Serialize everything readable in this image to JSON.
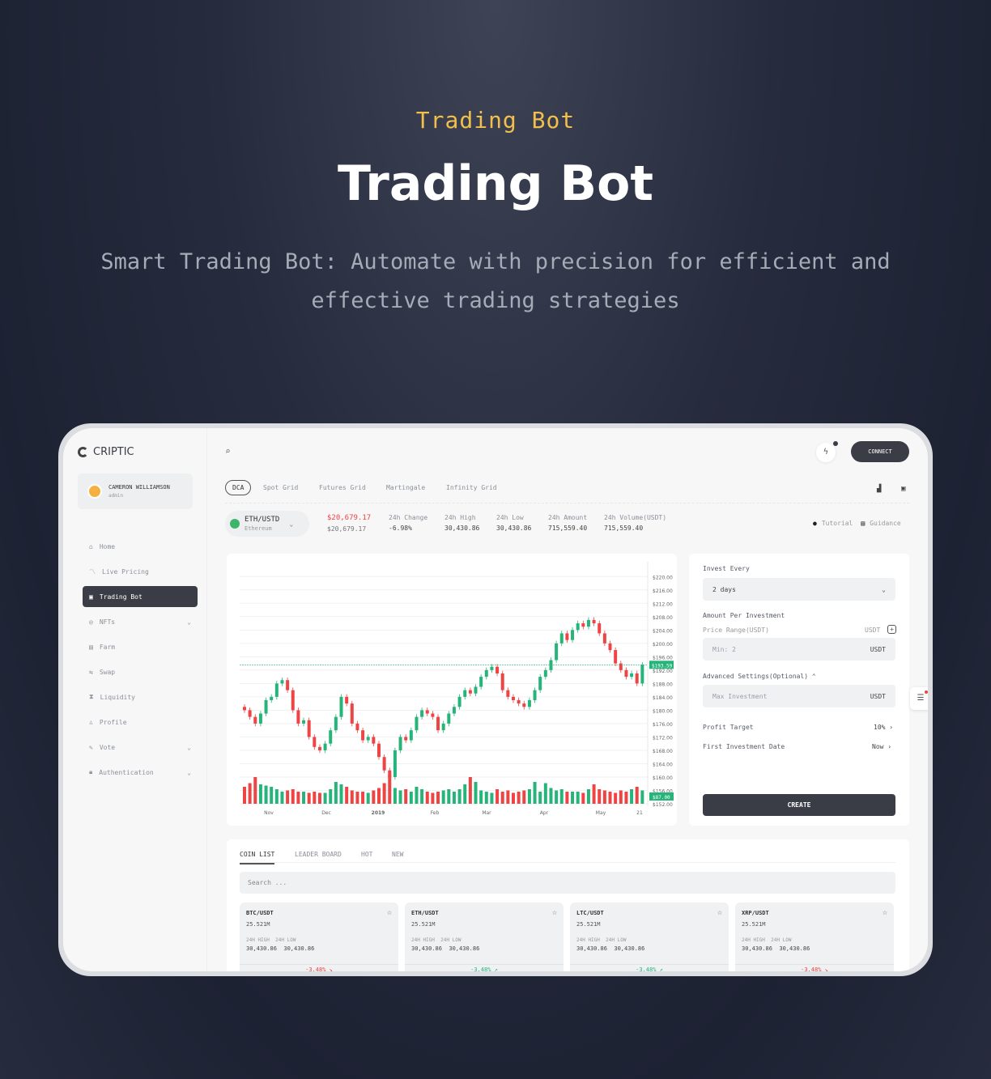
{
  "hero": {
    "eyebrow": "Trading Bot",
    "title": "Trading Bot",
    "subtitle": "Smart Trading Bot: Automate with precision for efficient and effective trading strategies"
  },
  "colors": {
    "accent": "#f2c04a",
    "up": "#26b47a",
    "down": "#ef4444",
    "dark": "#3a3d45"
  },
  "app": {
    "brand": "CRIPTIC",
    "connect": "CONNECT"
  },
  "user": {
    "name": "CAMERON WILLIAMSON",
    "role": "admin"
  },
  "sidebar": {
    "items": [
      {
        "label": "Home",
        "icon": "home-icon"
      },
      {
        "label": "Live Pricing",
        "icon": "chart-line-icon"
      },
      {
        "label": "Trading Bot",
        "icon": "bot-icon",
        "active": true
      },
      {
        "label": "NFTs",
        "icon": "nft-icon",
        "chevron": true
      },
      {
        "label": "Farm",
        "icon": "farm-icon"
      },
      {
        "label": "Swap",
        "icon": "swap-icon"
      },
      {
        "label": "Liquidity",
        "icon": "hourglass-icon"
      },
      {
        "label": "Profile",
        "icon": "user-icon"
      },
      {
        "label": "Vote",
        "icon": "vote-icon",
        "chevron": true
      },
      {
        "label": "Authentication",
        "icon": "lock-icon",
        "chevron": true
      }
    ]
  },
  "bot_tabs": [
    "DCA",
    "Spot Grid",
    "Futures Grid",
    "Martingale",
    "Infinity Grid"
  ],
  "ticker": {
    "pair": "ETH/USTD",
    "name": "Ethereum",
    "price": "$20,679.17",
    "price_sub": "$20,679.17",
    "stats": [
      {
        "label": "24h Change",
        "value": "-6.98%"
      },
      {
        "label": "24h High",
        "value": "30,430.86"
      },
      {
        "label": "24h Low",
        "value": "30,430.86"
      },
      {
        "label": "24h Amount",
        "value": "715,559.40"
      },
      {
        "label": "24h Volume(USDT)",
        "value": "715,559.40"
      }
    ],
    "tutorial": "Tutorial",
    "guidance": "Guidance"
  },
  "chart_data": {
    "type": "candlestick",
    "y_ticks": [
      "$220.00",
      "$216.00",
      "$212.00",
      "$208.00",
      "$204.00",
      "$200.00",
      "$196.00",
      "$192.00",
      "$188.00",
      "$184.00",
      "$180.00",
      "$176.00",
      "$172.00",
      "$168.00",
      "$164.00",
      "$160.00",
      "$156.00",
      "$152.00"
    ],
    "ylim": [
      152,
      222
    ],
    "x_ticks": [
      "Nov",
      "Dec",
      "2019",
      "Feb",
      "Mar",
      "Apr",
      "May",
      "21"
    ],
    "last_price": "$193.59",
    "last_volume": "$87.00",
    "close": [
      180,
      178,
      176,
      179,
      183,
      184,
      188,
      189,
      186,
      180,
      176,
      177,
      172,
      169,
      168,
      170,
      174,
      178,
      184,
      182,
      176,
      174,
      171,
      172,
      170,
      166,
      162,
      160,
      168,
      172,
      171,
      174,
      178,
      180,
      179,
      178,
      174,
      176,
      179,
      181,
      184,
      186,
      185,
      187,
      190,
      192,
      193,
      191,
      186,
      184,
      183,
      182,
      181,
      183,
      186,
      190,
      192,
      195,
      200,
      203,
      201,
      204,
      206,
      205,
      207,
      206,
      203,
      200,
      198,
      194,
      192,
      190,
      191,
      188,
      193.59
    ],
    "volume": [
      14,
      17,
      22,
      16,
      15,
      14,
      12,
      10,
      11,
      12,
      10,
      10,
      9,
      10,
      9,
      9,
      12,
      18,
      16,
      14,
      11,
      10,
      10,
      9,
      11,
      13,
      17,
      24,
      13,
      11,
      12,
      10,
      14,
      12,
      10,
      9,
      10,
      11,
      12,
      10,
      12,
      16,
      22,
      18,
      11,
      10,
      9,
      12,
      10,
      11,
      9,
      10,
      11,
      12,
      18,
      10,
      17,
      13,
      11,
      12,
      10,
      10,
      10,
      9,
      12,
      16,
      12,
      11,
      10,
      9,
      11,
      10,
      12,
      14,
      11
    ]
  },
  "form": {
    "invest_every": "Invest Every",
    "invest_value": "2 days",
    "amount_label": "Amount Per Investment",
    "price_range": "Price Range(USDT)",
    "unit": "USDT",
    "min_placeholder": "Min: 2",
    "advanced": "Advanced Settings(Optional)",
    "max_placeholder": "Max Investment",
    "profit_label": "Profit Target",
    "profit_value": "10%",
    "date_label": "First Investment Date",
    "date_value": "Now",
    "create": "CREATE"
  },
  "coin_tabs": [
    "COIN LIST",
    "LEADER BOARD",
    "HOT",
    "NEW"
  ],
  "coin_search_placeholder": "Search ...",
  "coins": [
    {
      "pair": "BTC/USDT",
      "volume": "25.521M",
      "high_label": "24H HIGH",
      "low_label": "24H LOW",
      "high": "30,430.86",
      "low": "30,430.86",
      "change": "-3.48%",
      "dir": "down"
    },
    {
      "pair": "ETH/USDT",
      "volume": "25.521M",
      "high_label": "24H HIGH",
      "low_label": "24H LOW",
      "high": "30,430.86",
      "low": "30,430.86",
      "change": "-3.48%",
      "dir": "up"
    },
    {
      "pair": "LTC/USDT",
      "volume": "25.521M",
      "high_label": "24H HIGH",
      "low_label": "24H LOW",
      "high": "30,430.86",
      "low": "30,430.86",
      "change": "-3.48%",
      "dir": "up"
    },
    {
      "pair": "XRP/USDT",
      "volume": "25.521M",
      "high_label": "24H HIGH",
      "low_label": "24H LOW",
      "high": "30,430.86",
      "low": "30,430.86",
      "change": "-3.48%",
      "dir": "down"
    }
  ]
}
